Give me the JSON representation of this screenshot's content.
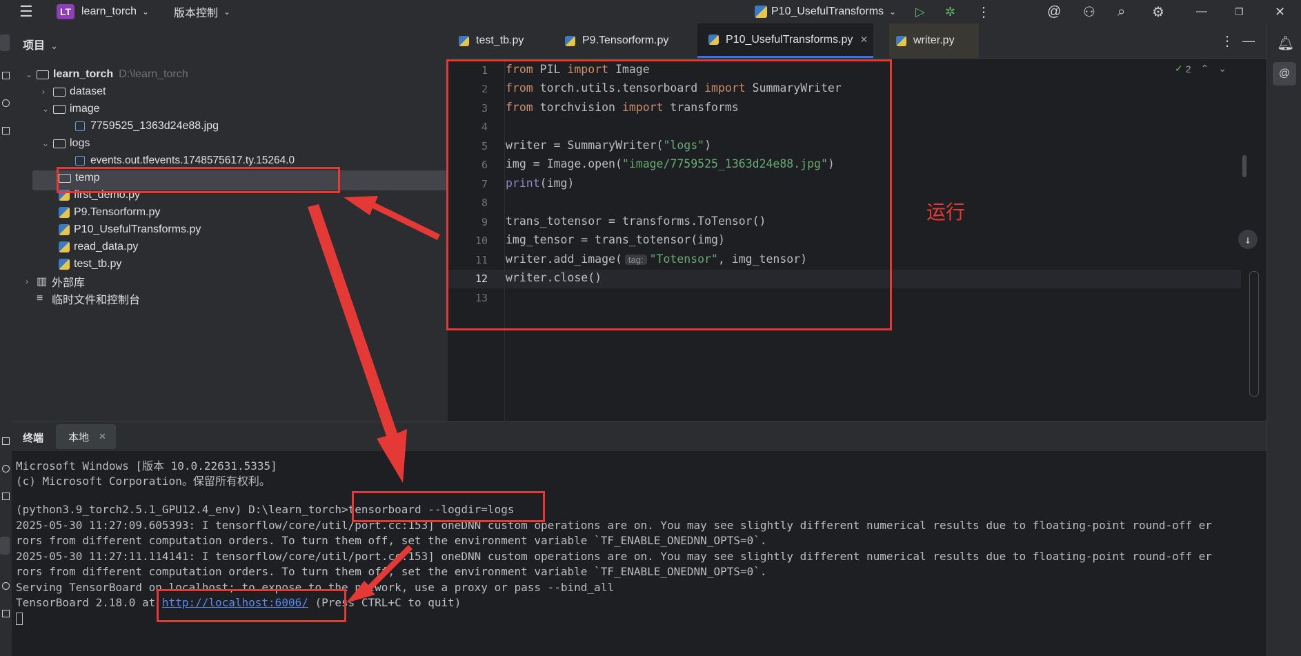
{
  "titlebar": {
    "project_badge": "LT",
    "project_name": "learn_torch",
    "vcs_label": "版本控制",
    "run_config": "P10_UsefulTransforms"
  },
  "project_panel": {
    "header": "项目",
    "tree": [
      {
        "label": "learn_torch",
        "path": "D:\\learn_torch"
      },
      {
        "label": "dataset"
      },
      {
        "label": "image"
      },
      {
        "label": "7759525_1363d24e88.jpg"
      },
      {
        "label": "logs"
      },
      {
        "label": "events.out.tfevents.1748575617.ty.15264.0"
      },
      {
        "label": "temp"
      },
      {
        "label": "first_demo.py"
      },
      {
        "label": "P9.Tensorform.py"
      },
      {
        "label": "P10_UsefulTransforms.py"
      },
      {
        "label": "read_data.py"
      },
      {
        "label": "test_tb.py"
      },
      {
        "label": "外部库"
      },
      {
        "label": "临时文件和控制台"
      }
    ]
  },
  "editor": {
    "tabs": [
      "test_tb.py",
      "P9.Tensorform.py",
      "P10_UsefulTransforms.py",
      "writer.py"
    ],
    "active_tab": "P10_UsefulTransforms.py",
    "inspection_count": "2",
    "line_numbers": [
      "1",
      "2",
      "3",
      "4",
      "5",
      "6",
      "7",
      "8",
      "9",
      "10",
      "11",
      "12",
      "13"
    ],
    "code": {
      "l1": [
        "from",
        " PIL ",
        "import",
        " Image"
      ],
      "l2": [
        "from",
        " torch.utils.tensorboard ",
        "import",
        " SummaryWriter"
      ],
      "l3": [
        "from",
        " torchvision ",
        "import",
        " transforms"
      ],
      "l5": [
        "writer = SummaryWriter(",
        "\"logs\"",
        ")"
      ],
      "l6": [
        "img = Image.open(",
        "\"image/7759525_1363d24e88.jpg\"",
        ")"
      ],
      "l7": [
        "print",
        "(img)"
      ],
      "l9": "trans_totensor = transforms.ToTensor()",
      "l10": "img_tensor = trans_totensor(img)",
      "l11": [
        "writer.add_image(",
        "tag:",
        "\"Totensor\"",
        ", img_tensor)"
      ],
      "l12": "writer.close()"
    }
  },
  "terminal": {
    "tab_label": "终端",
    "session_tab": "本地",
    "lines": [
      "Microsoft Windows [版本 10.0.22631.5335]",
      "(c) Microsoft Corporation。保留所有权利。",
      "",
      "(python3.9_torch2.5.1_GPU12.4_env) D:\\learn_torch>tensorboard --logdir=logs",
      "2025-05-30 11:27:09.605393: I tensorflow/core/util/port.cc:153] oneDNN custom operations are on. You may see slightly different numerical results due to floating-point round-off er",
      "rors from different computation orders. To turn them off, set the environment variable `TF_ENABLE_ONEDNN_OPTS=0`.",
      "2025-05-30 11:27:11.114141: I tensorflow/core/util/port.cc:153] oneDNN custom operations are on. You may see slightly different numerical results due to floating-point round-off er",
      "rors from different computation orders. To turn them off, set the environment variable `TF_ENABLE_ONEDNN_OPTS=0`.",
      "Serving TensorBoard on localhost; to expose to the network, use a proxy or pass --bind_all"
    ],
    "last_prefix": "TensorBoard 2.18.0 at ",
    "last_link": "http://localhost:6006/",
    "last_suffix": " (Press CTRL+C to quit)"
  },
  "annotations": {
    "run_label": "运行",
    "color": "#e53935"
  }
}
